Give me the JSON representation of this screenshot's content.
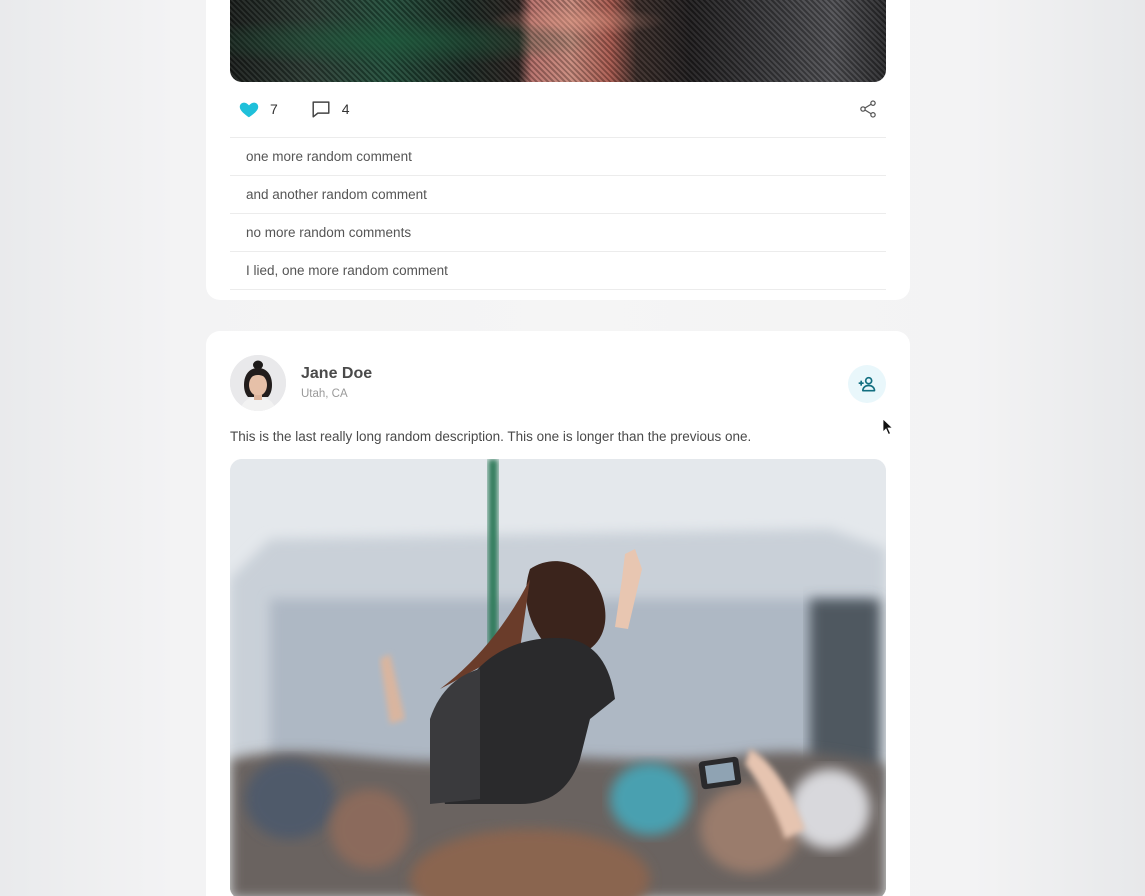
{
  "post_prev": {
    "photo": "concert-photo",
    "likes": "7",
    "comments_count": "4",
    "icons": {
      "like": "heart-icon",
      "comment": "comment-icon",
      "share": "share-icon"
    },
    "comments": [
      "one more random comment",
      "and another random comment",
      "no more random comments",
      "I lied, one more random comment"
    ]
  },
  "post": {
    "author_name": "Jane Doe",
    "author_location": "Utah, CA",
    "description": "This is the last really long random description. This one is longer than the previous one.",
    "follow_icon": "add-user-icon",
    "photo": "festival-crowd-photo"
  },
  "colors": {
    "accent": "#1fc0da",
    "follow_bg": "#e9f7fb",
    "follow_icon": "#136f80"
  }
}
